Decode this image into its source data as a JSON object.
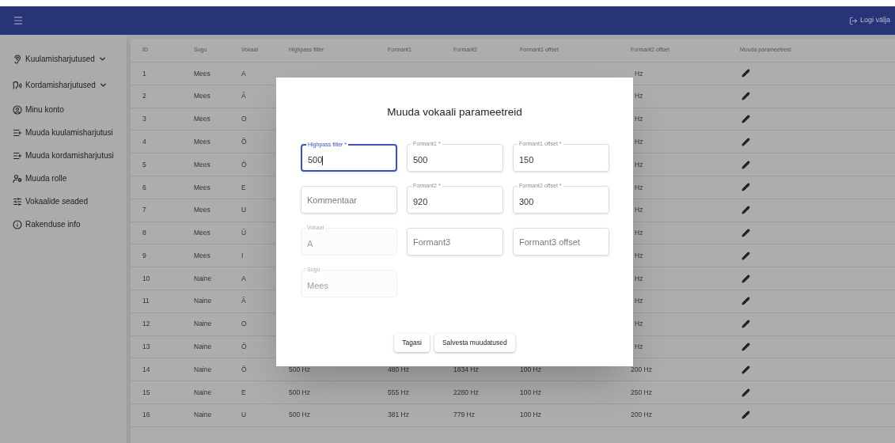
{
  "topbar": {
    "logout": "Logi välja"
  },
  "sidebar": {
    "items": [
      {
        "kind": "ear",
        "label": "Kuulamisharjutused",
        "expandable": true
      },
      {
        "kind": "voice",
        "label": "Kordamisharjutused",
        "expandable": true
      },
      {
        "kind": "account",
        "label": "Minu konto",
        "expandable": false
      },
      {
        "kind": "edit-list",
        "label": "Muuda kuulamisharjutusi",
        "expandable": false
      },
      {
        "kind": "edit-list",
        "label": "Muuda kordamisharjutusi",
        "expandable": false
      },
      {
        "kind": "roles",
        "label": "Muuda rolle",
        "expandable": false
      },
      {
        "kind": "sliders",
        "label": "Vokaalide seaded",
        "expandable": false
      },
      {
        "kind": "info",
        "label": "Rakenduse info",
        "expandable": false
      }
    ]
  },
  "table": {
    "columns": [
      "ID",
      "Sugu",
      "Vokaal",
      "Highpass filter",
      "Formant1",
      "Formant2",
      "Formant1 offset",
      "Formant2 offset",
      "Muuda parameetreid"
    ],
    "rows": [
      {
        "id": "1",
        "sugu": "Mees",
        "vokaal": "A",
        "formant2_offset": "Hz"
      },
      {
        "id": "2",
        "sugu": "Mees",
        "vokaal": "Ä",
        "formant2_offset": "Hz"
      },
      {
        "id": "3",
        "sugu": "Mees",
        "vokaal": "O",
        "formant2_offset": "Hz"
      },
      {
        "id": "4",
        "sugu": "Mees",
        "vokaal": "Õ",
        "formant2_offset": "Hz"
      },
      {
        "id": "5",
        "sugu": "Mees",
        "vokaal": "Ö",
        "formant2_offset": "Hz"
      },
      {
        "id": "6",
        "sugu": "Mees",
        "vokaal": "E",
        "formant2_offset": "Hz"
      },
      {
        "id": "7",
        "sugu": "Mees",
        "vokaal": "U",
        "formant2_offset": "Hz"
      },
      {
        "id": "8",
        "sugu": "Mees",
        "vokaal": "Ü",
        "formant2_offset": "Hz"
      },
      {
        "id": "9",
        "sugu": "Mees",
        "vokaal": "I",
        "formant2_offset": "Hz"
      },
      {
        "id": "10",
        "sugu": "Naine",
        "vokaal": "A",
        "formant2_offset": "Hz"
      },
      {
        "id": "11",
        "sugu": "Naine",
        "vokaal": "Ä",
        "formant2_offset": "Hz"
      },
      {
        "id": "12",
        "sugu": "Naine",
        "vokaal": "O",
        "formant2_offset": "Hz"
      },
      {
        "id": "13",
        "sugu": "Naine",
        "vokaal": "Õ",
        "formant2_offset": "Hz"
      },
      {
        "id": "14",
        "sugu": "Naine",
        "vokaal": "Ö",
        "highpass_filter": "500 Hz",
        "formant1": "480 Hz",
        "formant2": "1834 Hz",
        "formant1_offset": "100 Hz",
        "formant2_offset": "200 Hz"
      },
      {
        "id": "15",
        "sugu": "Naine",
        "vokaal": "E",
        "highpass_filter": "500 Hz",
        "formant1": "555 Hz",
        "formant2": "2280 Hz",
        "formant1_offset": "100 Hz",
        "formant2_offset": "250 Hz"
      },
      {
        "id": "16",
        "sugu": "Naine",
        "vokaal": "U",
        "highpass_filter": "500 Hz",
        "formant1": "381 Hz",
        "formant2": "779 Hz",
        "formant1_offset": "100 Hz",
        "formant2_offset": "200 Hz"
      }
    ]
  },
  "dialog": {
    "title": "Muuda vokaali parameetreid",
    "fields": [
      {
        "label": "Highpass filter *",
        "value": "500",
        "focused": true,
        "disabled": false
      },
      {
        "label": "Formant1 *",
        "value": "500",
        "focused": false,
        "disabled": false
      },
      {
        "label": "Formant1 offset *",
        "value": "150",
        "focused": false,
        "disabled": false
      },
      {
        "placeholder": "Kommentaar",
        "focused": false,
        "disabled": false
      },
      {
        "label": "Formant2 *",
        "value": "920",
        "focused": false,
        "disabled": false
      },
      {
        "label": "Formant2 offset *",
        "value": "300",
        "focused": false,
        "disabled": false
      },
      {
        "label": "Vokaal",
        "value": "A",
        "focused": false,
        "disabled": true
      },
      {
        "placeholder": "Formant3",
        "focused": false,
        "disabled": false
      },
      {
        "placeholder": "Formant3 offset",
        "focused": false,
        "disabled": false
      },
      {
        "label": "Sugu",
        "value": "Mees",
        "focused": false,
        "disabled": true
      }
    ],
    "buttons": [
      "Tagasi",
      "Salvesta muudatused"
    ]
  }
}
